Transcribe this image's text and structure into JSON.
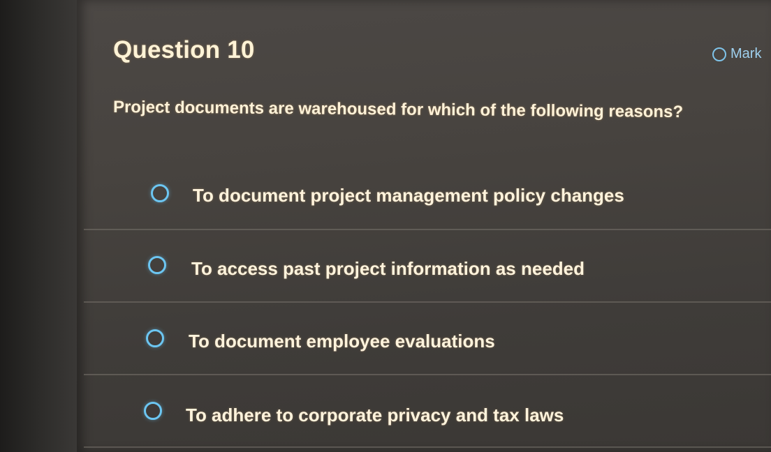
{
  "question": {
    "title": "Question 10",
    "mark_label": "Mark",
    "prompt": "Project documents are warehoused for which of the following reasons?"
  },
  "options": [
    {
      "label": "To document project management policy changes",
      "selected": false
    },
    {
      "label": "To access past project information as needed",
      "selected": false
    },
    {
      "label": "To document employee evaluations",
      "selected": false
    },
    {
      "label": "To adhere to corporate privacy and tax laws",
      "selected": false
    }
  ],
  "colors": {
    "radio_accent": "#6cc6f2",
    "text": "#fff3dc",
    "background": "#47433f"
  }
}
